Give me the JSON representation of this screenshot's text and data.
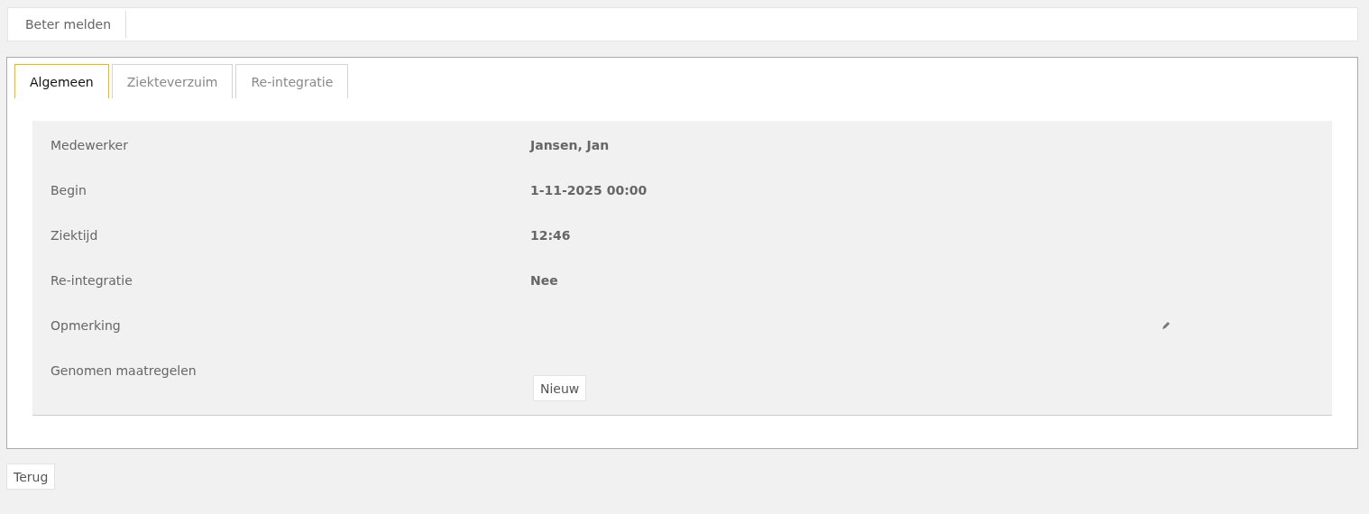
{
  "toolbar": {
    "buttons": [
      "Beter melden"
    ]
  },
  "tabs": [
    {
      "label": "Algemeen",
      "selected": true
    },
    {
      "label": "Ziekteverzuim",
      "selected": false
    },
    {
      "label": "Re-integratie",
      "selected": false
    }
  ],
  "fields": [
    {
      "kind": "text",
      "label": "Medewerker",
      "value": "Jansen, Jan"
    },
    {
      "kind": "text",
      "label": "Begin",
      "value": "1-11-2025 00:00"
    },
    {
      "kind": "text",
      "label": "Ziektijd",
      "value": "12:46"
    },
    {
      "kind": "text",
      "label": "Re-integratie",
      "value": "Nee"
    },
    {
      "kind": "editable",
      "label": "Opmerking"
    },
    {
      "kind": "list",
      "label": "Genomen maatregelen",
      "button": "Nieuw"
    }
  ],
  "footer": {
    "button": "Terug"
  }
}
